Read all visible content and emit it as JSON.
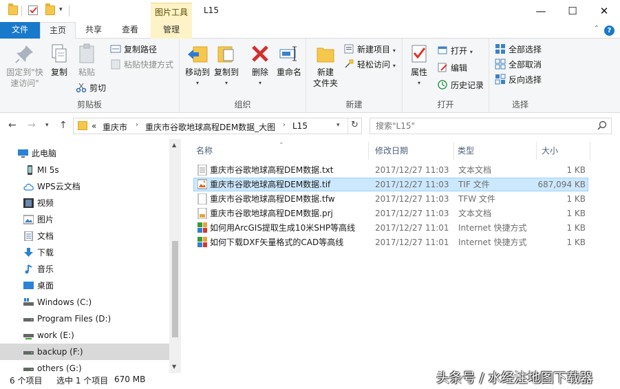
{
  "window": {
    "title": "L15",
    "context_tab_title": "图片工具",
    "minimize": "—",
    "maximize": "☐",
    "close": "✕"
  },
  "ribbon_tabs": [
    {
      "label": "文件"
    },
    {
      "label": "主页"
    },
    {
      "label": "共享"
    },
    {
      "label": "查看"
    },
    {
      "label": "管理"
    }
  ],
  "ribbon": {
    "clipboard": {
      "group_label": "剪贴板",
      "pin_label_1": "固定到\"快",
      "pin_label_2": "速访问\"",
      "copy": "复制",
      "paste": "粘贴",
      "copy_path": "复制路径",
      "paste_shortcut": "粘贴快捷方式",
      "cut": "剪切"
    },
    "organize": {
      "group_label": "组织",
      "move_to": "移动到",
      "copy_to": "复制到",
      "delete": "删除",
      "rename": "重命名"
    },
    "new": {
      "group_label": "新建",
      "new_folder_1": "新建",
      "new_folder_2": "文件夹",
      "new_item": "新建项目",
      "easy_access": "轻松访问"
    },
    "open": {
      "group_label": "打开",
      "properties": "属性",
      "open": "打开",
      "edit": "编辑",
      "history": "历史记录"
    },
    "select": {
      "group_label": "选择",
      "select_all": "全部选择",
      "select_none": "全部取消",
      "invert": "反向选择"
    }
  },
  "address": {
    "overflow": "«",
    "crumbs": [
      "重庆市",
      "重庆市谷歌地球高程DEM数据_大图",
      "L15"
    ],
    "search_placeholder": "搜索\"L15\""
  },
  "nav_items": [
    {
      "label": "此电脑"
    },
    {
      "label": "MI 5s"
    },
    {
      "label": "WPS云文档"
    },
    {
      "label": "视频"
    },
    {
      "label": "图片"
    },
    {
      "label": "文档"
    },
    {
      "label": "下载"
    },
    {
      "label": "音乐"
    },
    {
      "label": "桌面"
    },
    {
      "label": "Windows (C:)"
    },
    {
      "label": "Program Files (D:)"
    },
    {
      "label": "work (E:)"
    },
    {
      "label": "backup (F:)"
    },
    {
      "label": "others (G:)"
    }
  ],
  "columns": {
    "name": "名称",
    "date": "修改日期",
    "type": "类型",
    "size": "大小"
  },
  "files": [
    {
      "name": "重庆市谷歌地球高程DEM数据.txt",
      "date": "2017/12/27 11:03",
      "type": "文本文档",
      "size": "1 KB"
    },
    {
      "name": "重庆市谷歌地球高程DEM数据.tif",
      "date": "2017/12/27 11:03",
      "type": "TIF 文件",
      "size": "687,094 KB"
    },
    {
      "name": "重庆市谷歌地球高程DEM数据.tfw",
      "date": "2017/12/27 11:03",
      "type": "TFW 文件",
      "size": "1 KB"
    },
    {
      "name": "重庆市谷歌地球高程DEM数据.prj",
      "date": "2017/12/27 11:03",
      "type": "文本文档",
      "size": "1 KB"
    },
    {
      "name": "如何用ArcGIS提取生成10米SHP等高线",
      "date": "2017/12/27 11:01",
      "type": "Internet 快捷方式",
      "size": "1 KB"
    },
    {
      "name": "如何下载DXF矢量格式的CAD等高线",
      "date": "2017/12/27 11:01",
      "type": "Internet 快捷方式",
      "size": "1 KB"
    }
  ],
  "status": {
    "count": "6 个项目",
    "selected": "选中 1 个项目",
    "selected_size": "670 MB"
  },
  "watermark": "头条号 / 水经注地图下载器",
  "colors": {
    "accent": "#1979ca",
    "selection": "#cce8ff",
    "context_tab": "#fdf3c6"
  }
}
